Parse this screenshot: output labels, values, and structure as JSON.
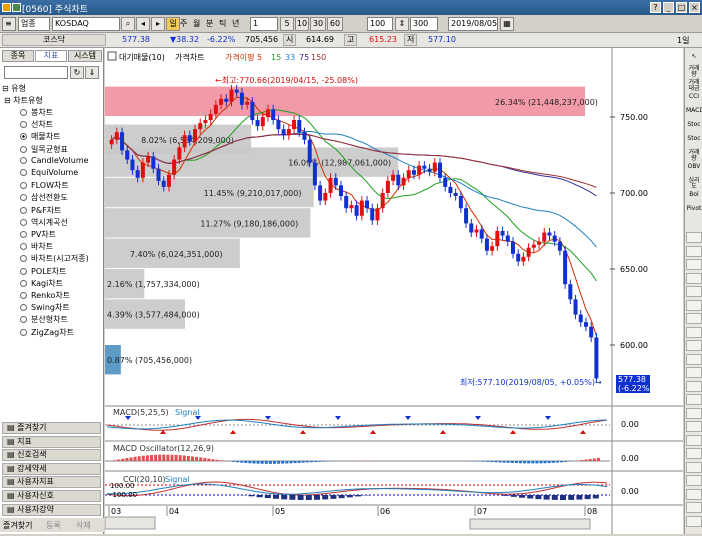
{
  "window": {
    "title": "[0560] 주식차트"
  },
  "toolbar": {
    "market": "업종",
    "index": "KOSDAQ",
    "periods": [
      "주",
      "월",
      "분",
      "틱",
      "년"
    ],
    "period_count": "1",
    "intervals": [
      "5",
      "10",
      "30",
      "60"
    ],
    "zoom_value": "100",
    "count_value": "300",
    "date": "2019/08/05",
    "right_label": "1일"
  },
  "quote": {
    "name": "코스닥",
    "price": "577.38",
    "change": "▼38.32",
    "change_pct": "-6.22%",
    "volume": "705,456",
    "open_label": "시",
    "open": "614.69",
    "high_label": "고",
    "high": "615.23",
    "low_label": "저",
    "low": "577.10"
  },
  "left_tabs": [
    "종목",
    "지표",
    "시스템"
  ],
  "tree": {
    "group": "유형",
    "sub": "차트유형",
    "items": [
      "봉차트",
      "선차트",
      "매물차트",
      "일목균형표",
      "CandleVolume",
      "EquiVolume",
      "FLOW차트",
      "삼선전환도",
      "P&F차트",
      "역시계곡선",
      "PV차트",
      "바차트",
      "바차트(시고저종)",
      "POLE차트",
      "Kagi차트",
      "Renko차트",
      "Swing차트",
      "분산형차트",
      "ZigZag차트"
    ],
    "selected_index": 2
  },
  "accordion": [
    "즐겨찾기",
    "지표",
    "신호검색",
    "강세약세",
    "사용자지표",
    "사용자신호",
    "사용자강약"
  ],
  "bottom_tabs": [
    "즐겨찾기",
    "등록",
    "삭제"
  ],
  "chart": {
    "legend": {
      "items": [
        "대기매물(10)",
        "가격차트",
        "가격이평 5",
        "15",
        "33",
        "75",
        "150"
      ]
    },
    "high_annotation": "←최고:770.66(2019/04/15, -25.08%)",
    "low_annotation": "최저:577.10(2019/08/05, +0.05%)→",
    "price_ticks": [
      "750.00",
      "700.00",
      "650.00",
      "600.00"
    ],
    "last_price": "577.38",
    "last_change": "(-6.22%)",
    "date_ticks": [
      "03",
      "04",
      "05",
      "06",
      "07",
      "08"
    ],
    "volume_profile": [
      {
        "label": "26.34% (21,448,237,000)",
        "pct": 26.34,
        "highlight": true
      },
      {
        "label": "16.09% (12,987,061,000)",
        "pct": 16.09
      },
      {
        "label": "8.02% (6,534,209,000)",
        "pct": 8.02
      },
      {
        "label": "11.45% (9,210,017,000)",
        "pct": 11.45
      },
      {
        "label": "11.27% (9,180,186,000)",
        "pct": 11.27
      },
      {
        "label": "7.40% (6,024,351,000)",
        "pct": 7.4
      },
      {
        "label": "2.16% (1,757,334,000)",
        "pct": 2.16
      },
      {
        "label": "4.39% (3,577,484,000)",
        "pct": 4.39
      },
      {
        "label": "0.87% (705,456,000)",
        "pct": 0.87
      }
    ],
    "macd_label": "MACD(5,25,5)",
    "macd_signal": "Signal",
    "macd_value": "0.00",
    "osc_label": "MACD Oscillator(12,26,9)",
    "osc_value": "0.00",
    "cci_label": "CCI(20,10)",
    "cci_signal": "Signal",
    "cci_value": "0.00",
    "cci_hi": "100.00",
    "cci_lo": "-100.00"
  },
  "colors": {
    "up": "#e01010",
    "down": "#1030d0",
    "highlight": "#f08898",
    "profile": "#c8c8c8"
  }
}
